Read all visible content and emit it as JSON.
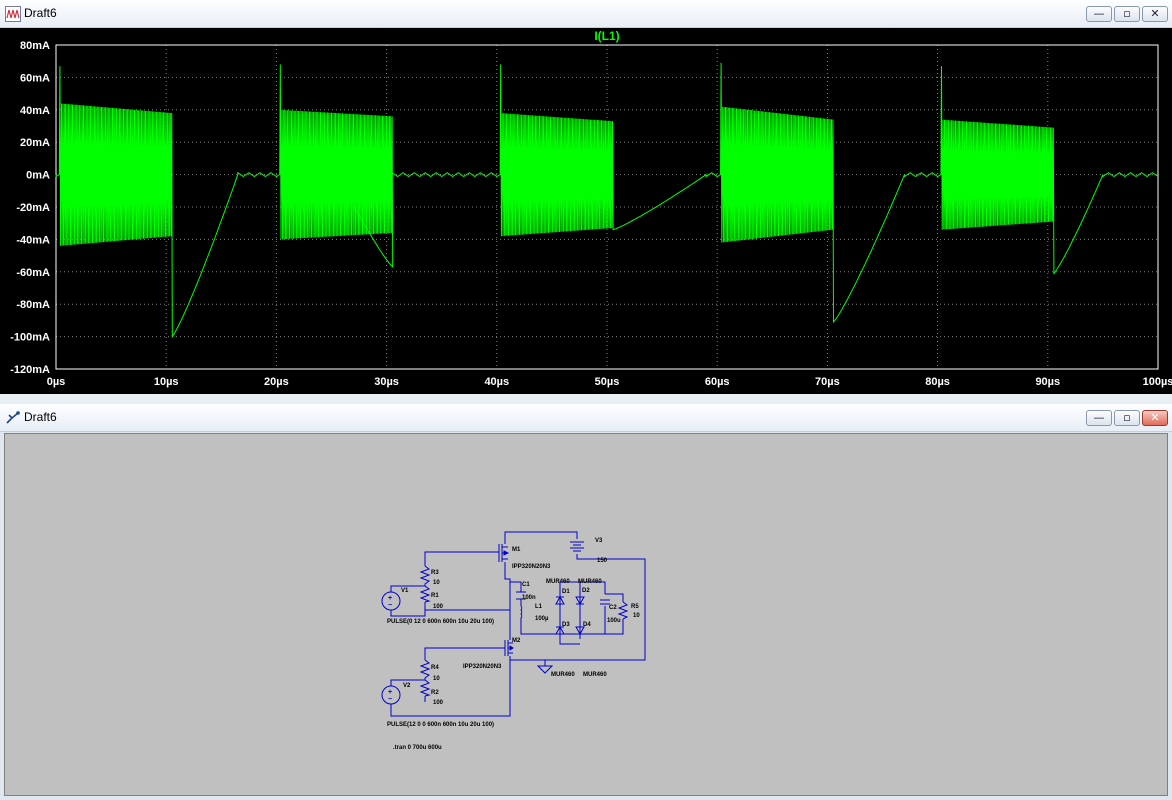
{
  "plot_window": {
    "title": "Draft6",
    "buttons": {
      "minimize": "—",
      "restore": "▫",
      "close": "✕"
    }
  },
  "schematic_window": {
    "title": "Draft6",
    "buttons": {
      "minimize": "—",
      "restore": "▫",
      "close": "✕"
    }
  },
  "colors": {
    "plot_background": "#000000",
    "trace": "#00ff00",
    "grid": "#808080",
    "axis_text": "#ffffff",
    "schematic_background": "#c0c0c0",
    "wire": "#0000cc"
  },
  "chart_data": {
    "type": "line",
    "title": "I(L1)",
    "xlabel": "",
    "ylabel": "",
    "xlim": [
      0,
      100
    ],
    "ylim": [
      -120,
      80
    ],
    "x_unit": "µs",
    "y_unit": "mA",
    "x_ticks": [
      "0µs",
      "10µs",
      "20µs",
      "30µs",
      "40µs",
      "50µs",
      "60µs",
      "70µs",
      "80µs",
      "90µs",
      "100µs"
    ],
    "y_ticks": [
      "80mA",
      "60mA",
      "40mA",
      "20mA",
      "0mA",
      "-20mA",
      "-40mA",
      "-60mA",
      "-80mA",
      "-100mA",
      "-120mA"
    ],
    "grid": true,
    "bursts": [
      {
        "start": 0.3,
        "end": 10.5,
        "peak": 67,
        "amp_start": 44,
        "amp_end": 38,
        "fall_to": -100,
        "recover_end": 16.5
      },
      {
        "start": 20.3,
        "end": 30.5,
        "peak": 68,
        "amp_start": 40,
        "amp_end": 36,
        "fall_to": -57,
        "recover_end": 25.5
      },
      {
        "start": 40.3,
        "end": 50.5,
        "peak": 68,
        "amp_start": 38,
        "amp_end": 33,
        "fall_to": -34,
        "recover_end": 59.0
      },
      {
        "start": 60.3,
        "end": 70.5,
        "peak": 69,
        "amp_start": 42,
        "amp_end": 34,
        "fall_to": -91,
        "recover_end": 77.0
      },
      {
        "start": 80.3,
        "end": 90.5,
        "peak": 67,
        "amp_start": 34,
        "amp_end": 29,
        "fall_to": -61,
        "recover_end": 95.0
      }
    ]
  },
  "schematic": {
    "labels": {
      "M1": "M1",
      "M1_model": "IPP320N20N3",
      "M2": "M2",
      "M2_model": "IPP320N20N3",
      "V1": "V1",
      "V2": "V2",
      "V3": "V3",
      "V3_value": "150",
      "R1": "R1",
      "R1_value": "100",
      "R2": "R2",
      "R2_value": "100",
      "R3": "R3",
      "R3_value": "10",
      "R4": "R4",
      "R4_value": "10",
      "R5": "R5",
      "R5_value": "10",
      "C1": "C1",
      "C1_value": "100n",
      "C2": "C2",
      "C2_value": "100u",
      "L1": "L1",
      "L1_value": "100µ",
      "D1": "D1",
      "D2": "D2",
      "D3": "D3",
      "D4": "D4",
      "D1_model": "MUR460",
      "D2_model": "MUR460",
      "D3_model": "MUR460",
      "D4_model": "MUR460",
      "V1_source": "PULSE(0 12 0 600n 600n 10u 20u 100)",
      "V2_source": "PULSE(12 0 0 600n 600n 10u 20u 100)",
      "tran_directive": ".tran 0 700u 600u"
    }
  }
}
